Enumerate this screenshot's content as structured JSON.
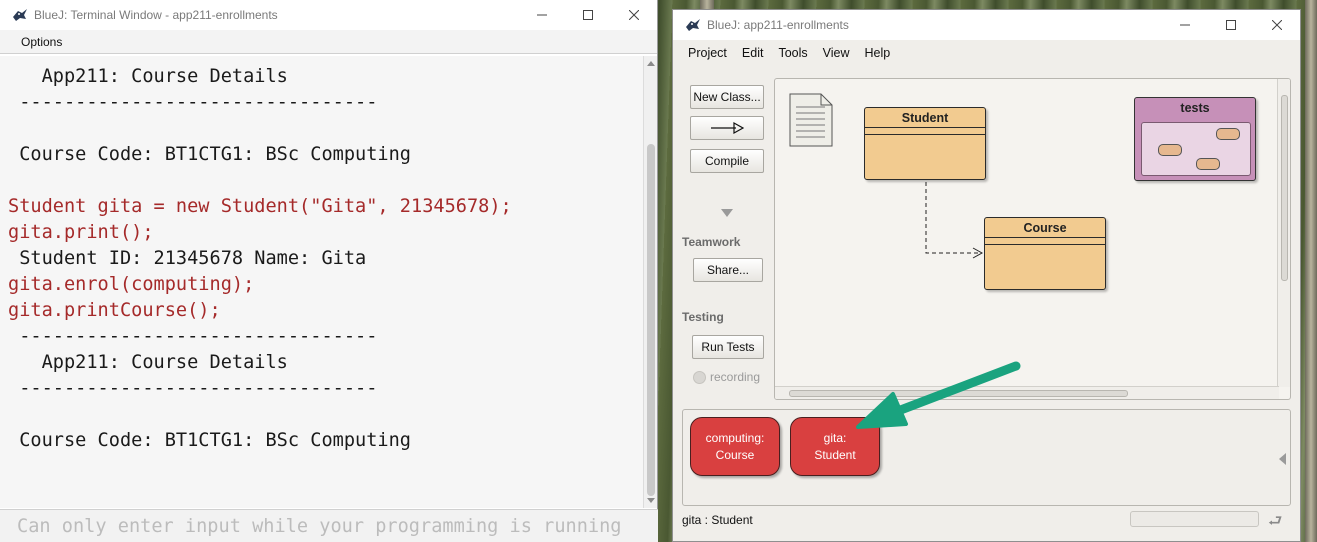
{
  "terminal": {
    "title": "BlueJ: Terminal Window - app211-enrollments",
    "menu": [
      "Options"
    ],
    "lines": [
      {
        "text": "   App211: Course Details",
        "kind": "out"
      },
      {
        "text": " --------------------------------",
        "kind": "out"
      },
      {
        "text": "",
        "kind": "out"
      },
      {
        "text": " Course Code: BT1CTG1: BSc Computing",
        "kind": "out"
      },
      {
        "text": "",
        "kind": "out"
      },
      {
        "text": "Student gita = new Student(\"Gita\", 21345678);",
        "kind": "cmd"
      },
      {
        "text": "gita.print();",
        "kind": "cmd"
      },
      {
        "text": " Student ID: 21345678 Name: Gita",
        "kind": "out"
      },
      {
        "text": "gita.enrol(computing);",
        "kind": "cmd"
      },
      {
        "text": "gita.printCourse();",
        "kind": "cmd"
      },
      {
        "text": " --------------------------------",
        "kind": "out"
      },
      {
        "text": "   App211: Course Details",
        "kind": "out"
      },
      {
        "text": " --------------------------------",
        "kind": "out"
      },
      {
        "text": "",
        "kind": "out"
      },
      {
        "text": " Course Code: BT1CTG1: BSc Computing",
        "kind": "out"
      }
    ],
    "input_placeholder": "Can only enter input while your programming is running"
  },
  "bluej": {
    "title": "BlueJ:  app211-enrollments",
    "menu": [
      "Project",
      "Edit",
      "Tools",
      "View",
      "Help"
    ],
    "buttons": {
      "new_class": "New Class...",
      "compile": "Compile",
      "share": "Share...",
      "run_tests": "Run Tests"
    },
    "labels": {
      "teamwork": "Teamwork",
      "testing": "Testing",
      "recording": "recording"
    },
    "classes": [
      "Student",
      "Course"
    ],
    "package": "tests",
    "objects": [
      {
        "line1": "computing:",
        "line2": "Course"
      },
      {
        "line1": "gita:",
        "line2": "Student"
      }
    ],
    "status": "gita : Student"
  },
  "colors": {
    "class_fill": "#f2cb90",
    "package_fill": "#c690b8",
    "object_fill": "#d94040",
    "command_text": "#a52a2a",
    "annotation_arrow": "#1aa37f"
  }
}
